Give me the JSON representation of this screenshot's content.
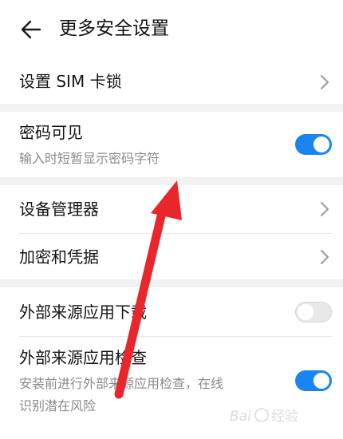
{
  "header": {
    "title": "更多安全设置",
    "back_icon": "arrow-left-icon"
  },
  "sections": [
    {
      "items": [
        {
          "label": "设置 SIM 卡锁",
          "control": "chevron"
        }
      ]
    },
    {
      "items": [
        {
          "label": "密码可见",
          "subtitle": "输入时短暂显示密码字符",
          "control": "toggle",
          "state": "on"
        }
      ]
    },
    {
      "items": [
        {
          "label": "设备管理器",
          "control": "chevron"
        },
        {
          "label": "加密和凭据",
          "control": "chevron"
        }
      ]
    },
    {
      "items": [
        {
          "label": "外部来源应用下载",
          "control": "toggle",
          "state": "off"
        },
        {
          "label": "外部来源应用检查",
          "subtitle_lines": [
            "安装前进行外部来源应用检查，在线",
            "识别潜在风险"
          ],
          "control": "toggle",
          "state": "on"
        }
      ]
    }
  ],
  "colors": {
    "toggle_on": "#1a84f0",
    "toggle_off": "#e8e8e8",
    "annotation_arrow": "#e8262b",
    "section_gap": "#f2f2f2"
  },
  "watermark": "Baidu 经验"
}
